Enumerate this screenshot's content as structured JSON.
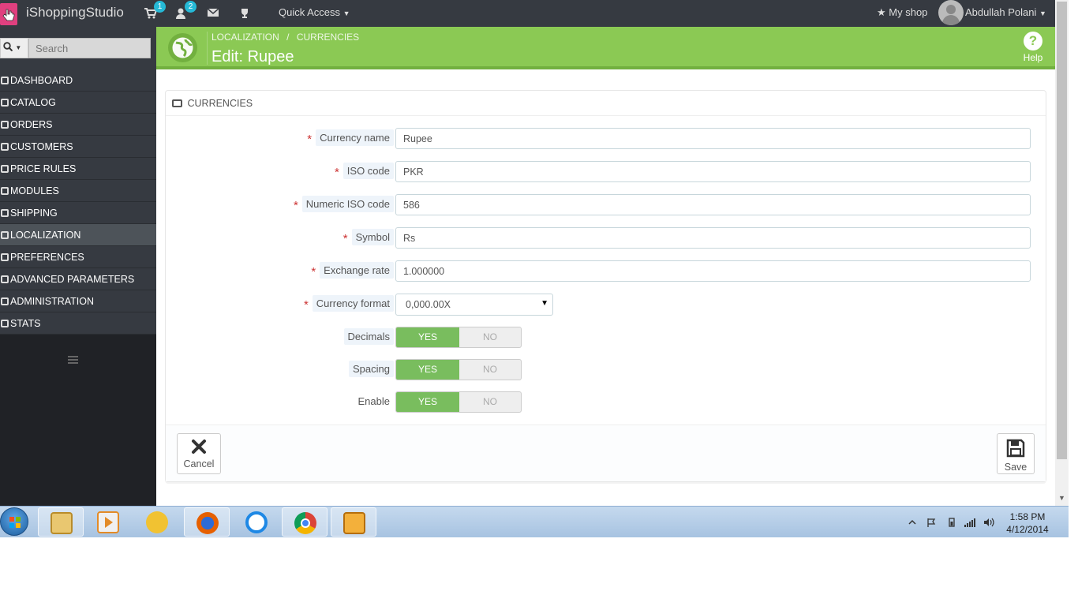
{
  "app": {
    "brand": "iShoppingStudio",
    "quick_access": "Quick Access",
    "my_shop": "My shop",
    "username": "Abdullah Polani",
    "badges": {
      "orders": "1",
      "customers": "2"
    }
  },
  "sidebar": {
    "search_placeholder": "Search",
    "items": [
      {
        "label": "DASHBOARD"
      },
      {
        "label": "CATALOG"
      },
      {
        "label": "ORDERS"
      },
      {
        "label": "CUSTOMERS"
      },
      {
        "label": "PRICE RULES"
      },
      {
        "label": "MODULES"
      },
      {
        "label": "SHIPPING"
      },
      {
        "label": "LOCALIZATION",
        "active": true
      },
      {
        "label": "PREFERENCES"
      },
      {
        "label": "ADVANCED PARAMETERS"
      },
      {
        "label": "ADMINISTRATION"
      },
      {
        "label": "STATS"
      }
    ]
  },
  "header": {
    "breadcrumb_1": "LOCALIZATION",
    "breadcrumb_sep": "/",
    "breadcrumb_2": "CURRENCIES",
    "title": "Edit: Rupee",
    "help": "Help",
    "help_glyph": "?"
  },
  "panel": {
    "heading": "CURRENCIES",
    "required_mark": "*",
    "fields": {
      "currency_name": {
        "label": "Currency name",
        "value": "Rupee"
      },
      "iso_code": {
        "label": "ISO code",
        "value": "PKR"
      },
      "numeric_iso_code": {
        "label": "Numeric ISO code",
        "value": "586"
      },
      "symbol": {
        "label": "Symbol",
        "value": "Rs"
      },
      "exchange_rate": {
        "label": "Exchange rate",
        "value": "1.000000"
      },
      "currency_format": {
        "label": "Currency format",
        "value": "0,000.00X"
      }
    },
    "switches": {
      "decimals": {
        "label": "Decimals",
        "yes": "YES",
        "no": "NO",
        "selected": "YES"
      },
      "spacing": {
        "label": "Spacing",
        "yes": "YES",
        "no": "NO",
        "selected": "YES"
      },
      "enable": {
        "label": "Enable",
        "yes": "YES",
        "no": "NO",
        "selected": "YES"
      }
    },
    "footer": {
      "cancel": "Cancel",
      "save": "Save"
    }
  },
  "taskbar": {
    "time": "1:58 PM",
    "date": "4/12/2014"
  },
  "colors": {
    "header_green": "#8bc954",
    "switch_green": "#79bd5e",
    "sidebar_dark": "#202226",
    "topbar": "#363a41",
    "badge_blue": "#25b9d7"
  }
}
